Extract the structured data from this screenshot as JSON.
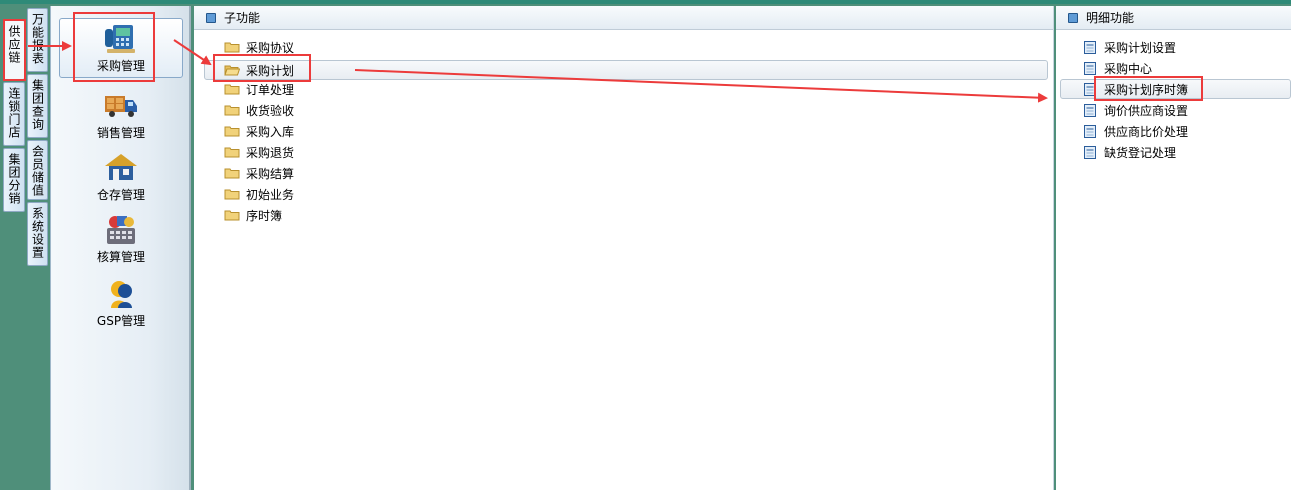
{
  "left_tabs_outer": [
    {
      "label": "供应链"
    },
    {
      "label": "连锁门店"
    },
    {
      "label": "集团分销"
    }
  ],
  "left_tabs_inner": [
    {
      "label": "万能报表"
    },
    {
      "label": "集团查询"
    },
    {
      "label": "会员储值"
    },
    {
      "label": "系统设置"
    }
  ],
  "modules": [
    {
      "label": "采购管理",
      "icon": "purchase-icon"
    },
    {
      "label": "销售管理",
      "icon": "truck-icon"
    },
    {
      "label": "仓存管理",
      "icon": "warehouse-icon"
    },
    {
      "label": "核算管理",
      "icon": "calculator-icon"
    },
    {
      "label": "GSP管理",
      "icon": "gsp-person-icon"
    }
  ],
  "sub_panel": {
    "title": "子功能",
    "items": [
      {
        "label": "采购协议"
      },
      {
        "label": "采购计划"
      },
      {
        "label": "订单处理"
      },
      {
        "label": "收货验收"
      },
      {
        "label": "采购入库"
      },
      {
        "label": "采购退货"
      },
      {
        "label": "采购结算"
      },
      {
        "label": "初始业务"
      },
      {
        "label": "序时簿"
      }
    ]
  },
  "detail_panel": {
    "title": "明细功能",
    "items": [
      {
        "label": "采购计划设置"
      },
      {
        "label": "采购中心"
      },
      {
        "label": "采购计划序时簿"
      },
      {
        "label": "询价供应商设置"
      },
      {
        "label": "供应商比价处理"
      },
      {
        "label": "缺货登记处理"
      }
    ]
  },
  "colors": {
    "annotation": "#ec3b3b",
    "accent": "#2e8a78"
  }
}
